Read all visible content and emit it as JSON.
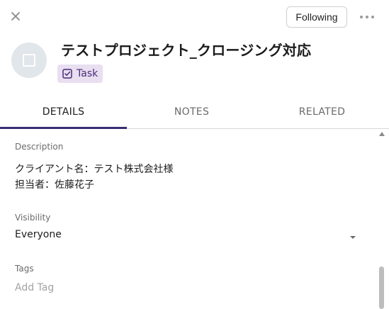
{
  "header": {
    "following_label": "Following"
  },
  "record": {
    "title": "テストプロジェクト_クロージング対応",
    "type_badge": "Task"
  },
  "tabs": [
    {
      "label": "DETAILS",
      "active": true
    },
    {
      "label": "NOTES",
      "active": false
    },
    {
      "label": "RELATED",
      "active": false
    }
  ],
  "details": {
    "description_label": "Description",
    "description_lines": [
      "クライアント名：テスト株式会社様",
      "担当者：佐藤花子"
    ],
    "visibility_label": "Visibility",
    "visibility_value": "Everyone",
    "tags_label": "Tags",
    "tags_placeholder": "Add Tag"
  },
  "colors": {
    "accent": "#3b2b73",
    "badge_bg": "#e8dff1",
    "badge_text": "#4b2a78",
    "avatar_bg": "#e1e6ea"
  },
  "icons": {
    "close": "close-icon",
    "more": "more-horizontal-icon",
    "avatar": "square-icon",
    "badge": "checkbox-icon",
    "dropdown": "chevron-down-icon",
    "scroll_up": "scroll-up-arrow-icon"
  }
}
